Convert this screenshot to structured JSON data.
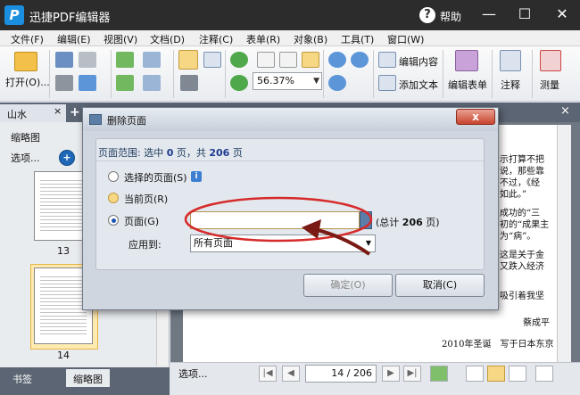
{
  "app": {
    "title": "迅捷PDF编辑器",
    "help": "帮助",
    "logo": "P"
  },
  "window_controls": [
    "—",
    "☐",
    "✕"
  ],
  "menu": [
    "文件(F)",
    "编辑(E)",
    "视图(V)",
    "文档(D)",
    "注释(C)",
    "表单(R)",
    "对象(B)",
    "工具(T)",
    "窗口(W)"
  ],
  "toolbar": {
    "open": "打开(O)...",
    "zoom": "56.37%",
    "edit_content": "编辑内容",
    "add_text": "添加文本",
    "edit_form": "编辑表单",
    "comment": "注释",
    "measure": "测量"
  },
  "tabs": {
    "doc": "山水",
    "close": "×",
    "add": "+",
    "panel_close": "×"
  },
  "left_panel": {
    "title": "缩略图",
    "select": "选项...",
    "thumbs": [
      "13",
      "14"
    ]
  },
  "bottom_tabs": [
    "书签",
    "缩略图"
  ],
  "doc_text": [
    "示打算不把",
    "说，那些靠",
    "不过，《经",
    "如此。”",
    "成功的“三",
    "初的“成果主",
    "为“病”。",
    "这是关于金",
    "又跌入经济",
    "吸引着我坚",
    "蔡成平",
    "2010年圣诞　写于日本东京"
  ],
  "nav": {
    "select": "选项...",
    "page": "14",
    "total": "206"
  },
  "dialog": {
    "title": "删除页面",
    "close": "x",
    "range_prefix": "页面范围: 选中 ",
    "range_selected": "0",
    "range_mid": " 页，共 ",
    "range_total": "206",
    "range_suffix": " 页",
    "options": [
      "选择的页面(S)",
      "当前页(R)",
      "页面(G)"
    ],
    "info": "i",
    "pages_value": "",
    "total_prefix": "(总计 ",
    "total_value": "206",
    "total_suffix": " 页)",
    "apply_label": "应用到:",
    "apply_value": "所有页面",
    "ok": "确定(O)",
    "cancel": "取消(C)"
  },
  "colors": {
    "annotation": "#d62b2b",
    "arrow": "#7a1a14",
    "accent": "#1d3b8f"
  }
}
